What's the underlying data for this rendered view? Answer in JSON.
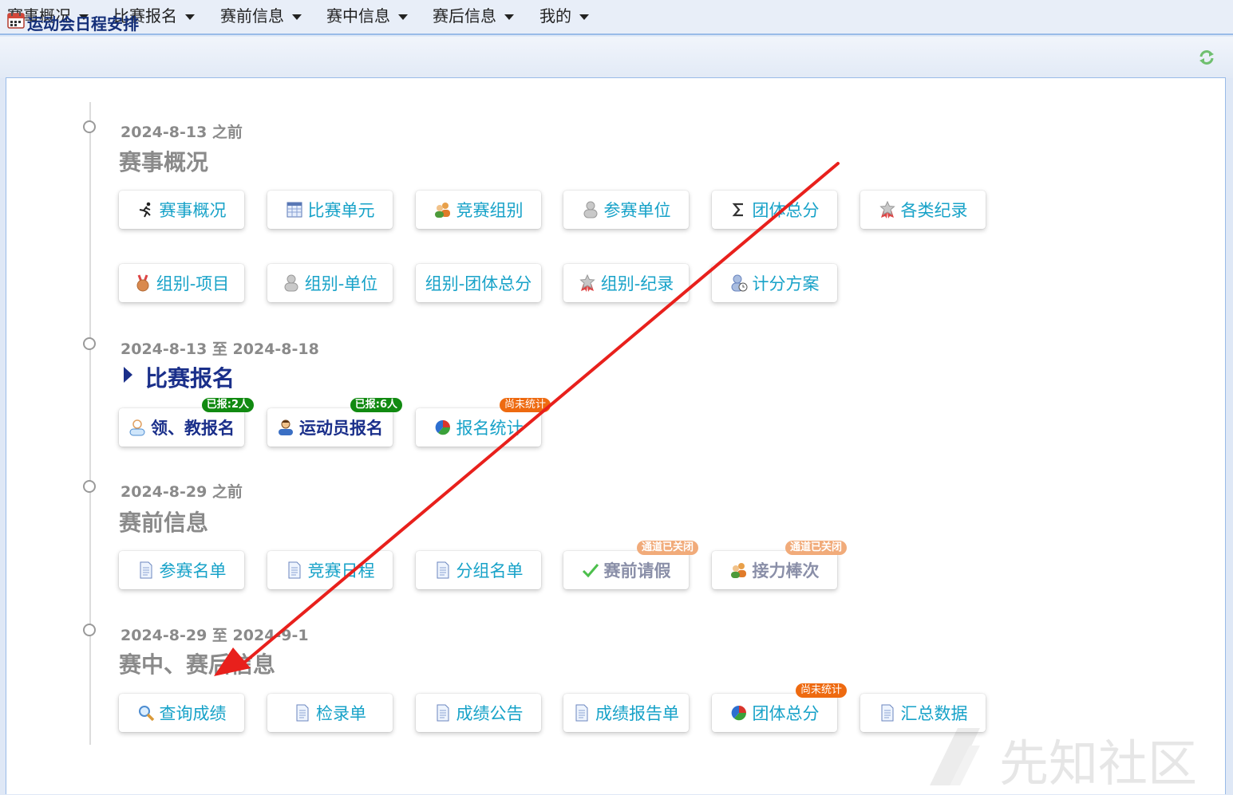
{
  "nav": [
    "赛事概况",
    "比赛报名",
    "赛前信息",
    "赛中信息",
    "赛后信息",
    "我的"
  ],
  "panel": {
    "title": "运动会日程安排"
  },
  "sections": [
    {
      "date": "2024-8-13 之前",
      "title": "赛事概况"
    },
    {
      "date": "2024-8-13 至 2024-8-18",
      "title": "比赛报名"
    },
    {
      "date": "2024-8-29 之前",
      "title": "赛前信息"
    },
    {
      "date": "2024-8-29 至 2024-9-1",
      "title": "赛中、赛后信息"
    }
  ],
  "buttons": {
    "overview": [
      {
        "label": "赛事概况",
        "icon": "runner-icon"
      },
      {
        "label": "比赛单元",
        "icon": "calendar-grid-icon"
      },
      {
        "label": "竞赛组别",
        "icon": "group-users-icon"
      },
      {
        "label": "参赛单位",
        "icon": "user-silhouette-icon"
      },
      {
        "label": "团体总分",
        "icon": "sigma-icon"
      },
      {
        "label": "各类纪录",
        "icon": "award-icon"
      },
      {
        "label": "组别-项目",
        "icon": "medal-icon"
      },
      {
        "label": "组别-单位",
        "icon": "user-silhouette-icon"
      },
      {
        "label": "组别-团体总分",
        "icon": ""
      },
      {
        "label": "组别-纪录",
        "icon": "award-icon"
      },
      {
        "label": "计分方案",
        "icon": "user-clock-icon"
      }
    ],
    "registration": [
      {
        "label": "领、教报名",
        "icon": "coach-icon",
        "badge": "已报:2人"
      },
      {
        "label": "运动员报名",
        "icon": "athlete-icon",
        "badge": "已报:6人"
      },
      {
        "label": "报名统计",
        "icon": "pie-chart-icon",
        "badge": "尚未统计"
      }
    ],
    "prematch": [
      {
        "label": "参赛名单",
        "icon": "document-icon"
      },
      {
        "label": "竞赛日程",
        "icon": "document-icon"
      },
      {
        "label": "分组名单",
        "icon": "document-icon"
      },
      {
        "label": "赛前请假",
        "icon": "check-icon",
        "badge": "通道已关闭"
      },
      {
        "label": "接力棒次",
        "icon": "relay-users-icon",
        "badge": "通道已关闭"
      }
    ],
    "results": [
      {
        "label": "查询成绩",
        "icon": "magnifier-icon"
      },
      {
        "label": "检录单",
        "icon": "document-icon"
      },
      {
        "label": "成绩公告",
        "icon": "document-icon"
      },
      {
        "label": "成绩报告单",
        "icon": "document-icon"
      },
      {
        "label": "团体总分",
        "icon": "pie-chart-icon",
        "badge": "尚未统计"
      },
      {
        "label": "汇总数据",
        "icon": "document-icon"
      }
    ]
  },
  "watermark": "先知社区",
  "colors": {
    "link": "#17a2c8",
    "active": "#1a2f8a",
    "muted": "#8a8a8a",
    "badge_green": "#118a11",
    "badge_orange": "#ee6a10",
    "badge_peach": "#f1ab7a",
    "arrow": "#e8201c"
  }
}
